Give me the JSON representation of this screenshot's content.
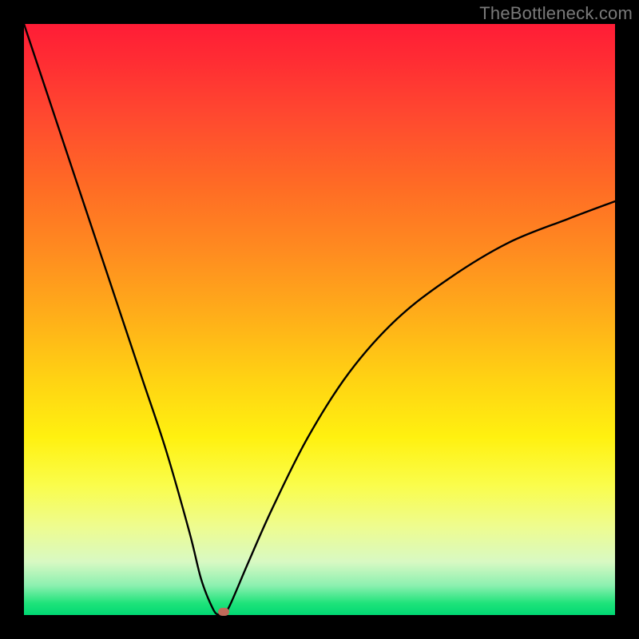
{
  "attribution": "TheBottleneck.com",
  "chart_data": {
    "type": "line",
    "title": "",
    "xlabel": "",
    "ylabel": "",
    "xlim": [
      0,
      100
    ],
    "ylim": [
      0,
      100
    ],
    "grid": false,
    "legend": false,
    "background_gradient": {
      "direction": "top-to-bottom",
      "stops": [
        {
          "pos": 0,
          "color": "#ff1c36"
        },
        {
          "pos": 50,
          "color": "#ffb019"
        },
        {
          "pos": 78,
          "color": "#fafd4b"
        },
        {
          "pos": 100,
          "color": "#00d873"
        }
      ]
    },
    "series": [
      {
        "name": "bottleneck-curve",
        "color": "#000000",
        "x": [
          0,
          4,
          8,
          12,
          16,
          20,
          24,
          28,
          30,
          32,
          33,
          33.8,
          35,
          38,
          42,
          48,
          55,
          63,
          72,
          82,
          92,
          100
        ],
        "y": [
          100,
          88,
          76,
          64,
          52,
          40,
          28,
          14,
          6,
          1,
          0,
          0,
          2,
          9,
          18,
          30,
          41,
          50,
          57,
          63,
          67,
          70
        ]
      }
    ],
    "marker": {
      "x": 33.8,
      "y": 0.5,
      "color": "#c06a5a"
    }
  }
}
